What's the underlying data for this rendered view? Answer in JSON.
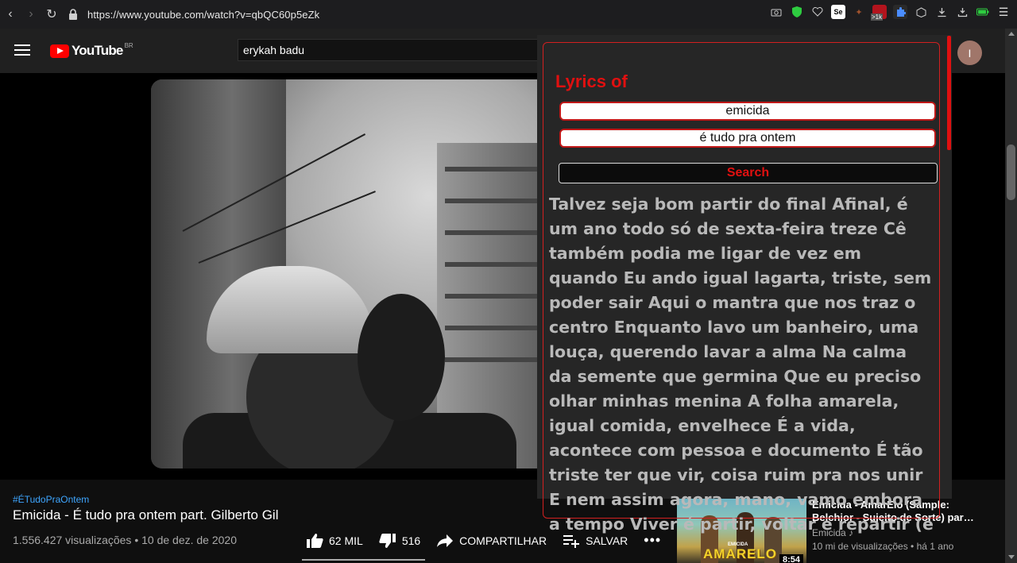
{
  "browser": {
    "url": "https://www.youtube.com/watch?v=qbQC60p5eZk",
    "ext_badge": ">1k"
  },
  "header": {
    "logo_text": "YouTube",
    "country": "BR",
    "search_value": "erykah badu",
    "avatar_initial": "I"
  },
  "video": {
    "hashtag": "#ÉTudoPraOntem",
    "title": "Emicida - É tudo pra ontem part. Gilberto Gil",
    "views_date": "1.556.427 visualizações • 10 de dez. de 2020",
    "likes": "62 MIL",
    "dislikes": "516",
    "share_label": "COMPARTILHAR",
    "save_label": "SALVAR"
  },
  "recommendation": {
    "title": "Emicida - AmarElo (Sample: Belchior - Sujeito de Sorte) par…",
    "channel": "Emicida ♪",
    "meta": "10 mi de visualizações • há 1 ano",
    "duration": "8:54",
    "thumb_text": "AMARELO",
    "thumb_small": "EMICIDA"
  },
  "lyrics_popup": {
    "title": "Lyrics of",
    "artist_value": "emicida",
    "song_value": "é tudo pra ontem",
    "search_label": "Search",
    "lyrics_text": "Talvez seja bom partir do final Afinal, é um ano todo só de sexta-feira treze Cê também podia me ligar de vez em quando Eu ando igual lagarta, triste, sem poder sair Aqui o mantra que nos traz o centro Enquanto lavo um banheiro, uma louça, querendo lavar a alma Na calma da semente que germina Que eu preciso olhar minhas menina A folha amarela, igual comida, envelhece É a vida, acontece com pessoa e documento É tão triste ter que vir, coisa ruim pra nos unir E nem assim agora, mano, vamo embora a tempo Viver é partir, voltar e repartir (é"
  },
  "colors": {
    "accent_red": "#e01010",
    "link_blue": "#3ea6ff",
    "background": "#0f0f0f"
  }
}
